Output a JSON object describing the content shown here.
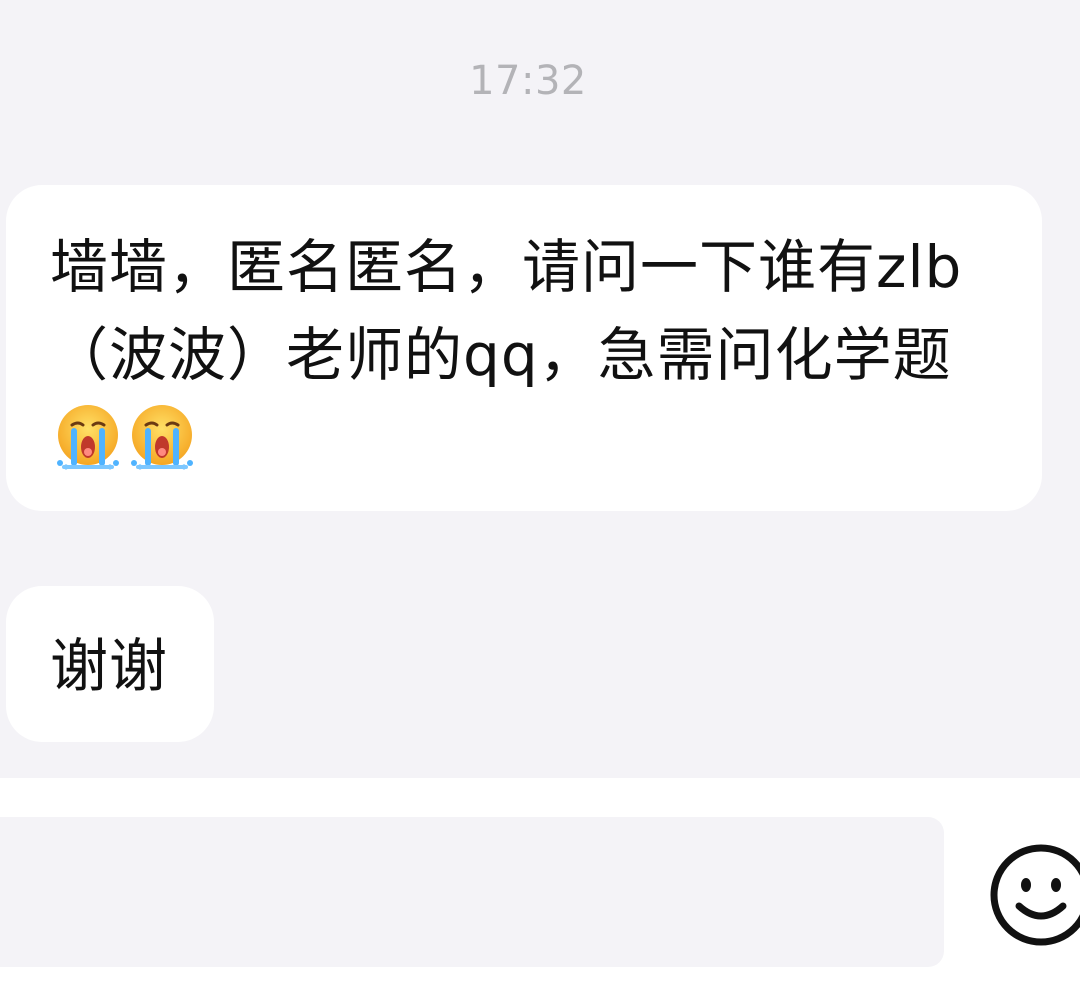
{
  "chat": {
    "timestamp": "17:32",
    "messages": [
      {
        "text": "墙墙，匿名匿名，请问一下谁有zlb（波波）老师的qq，急需问化学题",
        "emojis": [
          "crying-face-icon",
          "crying-face-icon"
        ]
      },
      {
        "text": "谢谢"
      }
    ]
  },
  "input": {
    "value": "",
    "placeholder": "",
    "emoji_button_icon": "smiley-face-icon"
  },
  "colors": {
    "background": "#f4f3f7",
    "bubble": "#ffffff",
    "timestamp": "#b3b3b7",
    "text": "#111111"
  }
}
